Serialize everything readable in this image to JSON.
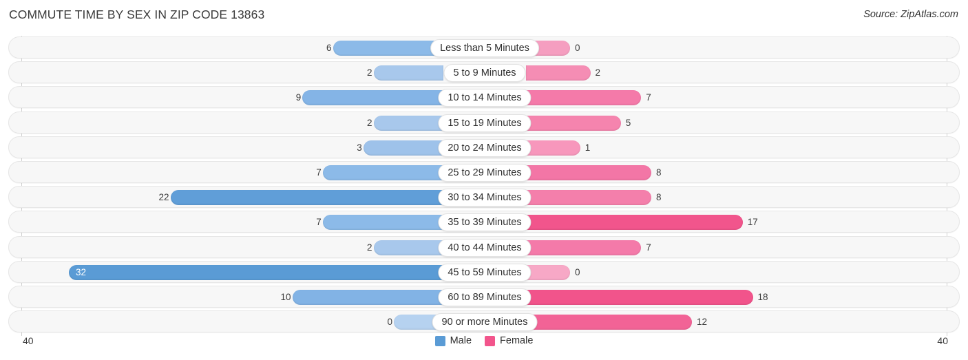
{
  "header": {
    "title": "COMMUTE TIME BY SEX IN ZIP CODE 13863",
    "source": "Source: ZipAtlas.com"
  },
  "legend": {
    "male_label": "Male",
    "female_label": "Female",
    "male_color": "#5a9bd5",
    "female_color": "#f2558c"
  },
  "axis": {
    "left_tick": "40",
    "right_tick": "40",
    "max": 40
  },
  "chart_data": {
    "type": "bar",
    "subtype": "diverging-bidirectional-bar",
    "title": "COMMUTE TIME BY SEX IN ZIP CODE 13863",
    "xlabel": "",
    "ylabel": "",
    "xlim": [
      40,
      40
    ],
    "grid": false,
    "legend_position": "bottom-center",
    "categories": [
      "Less than 5 Minutes",
      "5 to 9 Minutes",
      "10 to 14 Minutes",
      "15 to 19 Minutes",
      "20 to 24 Minutes",
      "25 to 29 Minutes",
      "30 to 34 Minutes",
      "35 to 39 Minutes",
      "40 to 44 Minutes",
      "45 to 59 Minutes",
      "60 to 89 Minutes",
      "90 or more Minutes"
    ],
    "series": [
      {
        "name": "Male",
        "values": [
          6,
          2,
          9,
          2,
          3,
          7,
          22,
          7,
          2,
          32,
          10,
          0
        ]
      },
      {
        "name": "Female",
        "values": [
          0,
          2,
          7,
          5,
          1,
          8,
          8,
          17,
          7,
          0,
          18,
          12
        ]
      }
    ]
  },
  "rows": [
    {
      "category": "Less than 5 Minutes",
      "male": "6",
      "female": "0",
      "male_value": 6,
      "female_value": 0,
      "male_color": "#8cbae8",
      "female_color": "#f59ec0",
      "male_inside": false
    },
    {
      "category": "5 to 9 Minutes",
      "male": "2",
      "female": "2",
      "male_value": 2,
      "female_value": 2,
      "male_color": "#a8c8ec",
      "female_color": "#f58db4",
      "male_inside": false
    },
    {
      "category": "10 to 14 Minutes",
      "male": "9",
      "female": "7",
      "male_value": 9,
      "female_value": 7,
      "male_color": "#84b4e6",
      "female_color": "#f47aa9",
      "male_inside": false
    },
    {
      "category": "15 to 19 Minutes",
      "male": "2",
      "female": "5",
      "male_value": 2,
      "female_value": 5,
      "male_color": "#a8c8ec",
      "female_color": "#f584ae",
      "male_inside": false
    },
    {
      "category": "20 to 24 Minutes",
      "male": "3",
      "female": "1",
      "male_value": 3,
      "female_value": 1,
      "male_color": "#9ec2ea",
      "female_color": "#f797bc",
      "male_inside": false
    },
    {
      "category": "25 to 29 Minutes",
      "male": "7",
      "female": "8",
      "male_value": 7,
      "female_value": 8,
      "male_color": "#8cbae8",
      "female_color": "#f376a6",
      "male_inside": false
    },
    {
      "category": "30 to 34 Minutes",
      "male": "22",
      "female": "8",
      "male_value": 22,
      "female_value": 8,
      "male_color": "#609ed8",
      "female_color": "#f47fab",
      "male_inside": false
    },
    {
      "category": "35 to 39 Minutes",
      "male": "7",
      "female": "17",
      "male_value": 7,
      "female_value": 17,
      "male_color": "#8cbae8",
      "female_color": "#f1558c",
      "male_inside": false
    },
    {
      "category": "40 to 44 Minutes",
      "male": "2",
      "female": "7",
      "male_value": 2,
      "female_value": 7,
      "male_color": "#a8c8ec",
      "female_color": "#f47aa9",
      "male_inside": false
    },
    {
      "category": "45 to 59 Minutes",
      "male": "32",
      "female": "0",
      "male_value": 32,
      "female_value": 0,
      "male_color": "#5a9bd5",
      "female_color": "#f7a8c6",
      "male_inside": true
    },
    {
      "category": "60 to 89 Minutes",
      "male": "10",
      "female": "18",
      "male_value": 10,
      "female_value": 18,
      "male_color": "#82b3e5",
      "female_color": "#f1548b",
      "male_inside": false
    },
    {
      "category": "90 or more Minutes",
      "male": "0",
      "female": "12",
      "male_value": 0,
      "female_value": 12,
      "male_color": "#b6d2f0",
      "female_color": "#f26396",
      "male_inside": false
    }
  ]
}
